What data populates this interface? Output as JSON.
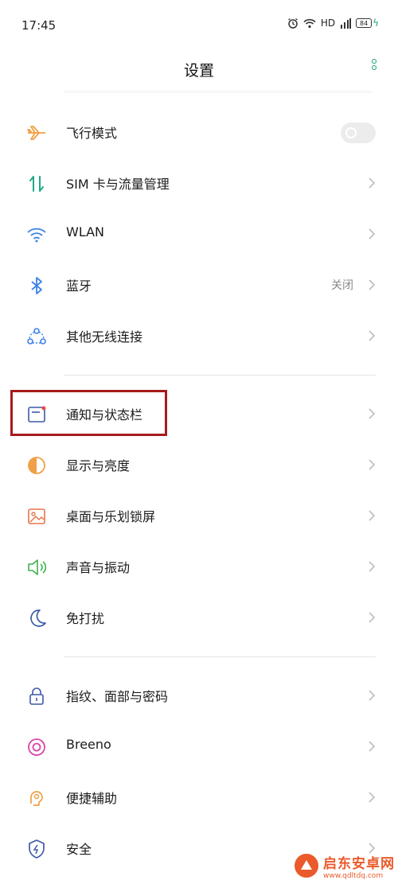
{
  "status_bar": {
    "time": "17:45",
    "network": "HD",
    "battery": "84"
  },
  "header": {
    "title": "设置"
  },
  "items": [
    {
      "label": "飞行模式",
      "icon": "airplane-icon",
      "value": "",
      "toggle": "off"
    },
    {
      "label": "SIM 卡与流量管理",
      "icon": "sim-data-icon",
      "value": ""
    },
    {
      "label": "WLAN",
      "icon": "wifi-icon",
      "value": ""
    },
    {
      "label": "蓝牙",
      "icon": "bluetooth-icon",
      "value": "关闭"
    },
    {
      "label": "其他无线连接",
      "icon": "wireless-connections-icon",
      "value": ""
    },
    {
      "label": "通知与状态栏",
      "icon": "notification-icon",
      "value": ""
    },
    {
      "label": "显示与亮度",
      "icon": "display-brightness-icon",
      "value": ""
    },
    {
      "label": "桌面与乐划锁屏",
      "icon": "wallpaper-icon",
      "value": ""
    },
    {
      "label": "声音与振动",
      "icon": "speaker-icon",
      "value": ""
    },
    {
      "label": "免打扰",
      "icon": "moon-icon",
      "value": ""
    },
    {
      "label": "指纹、面部与密码",
      "icon": "lock-icon",
      "value": ""
    },
    {
      "label": "Breeno",
      "icon": "breeno-icon",
      "value": ""
    },
    {
      "label": "便捷辅助",
      "icon": "assist-icon",
      "value": ""
    },
    {
      "label": "安全",
      "icon": "shield-icon",
      "value": ""
    }
  ],
  "colors": {
    "accent": "#14a36c",
    "highlight_box": "#a61b1b"
  },
  "watermark": {
    "title": "启东安卓网",
    "url": "www.qdltdq.com"
  }
}
